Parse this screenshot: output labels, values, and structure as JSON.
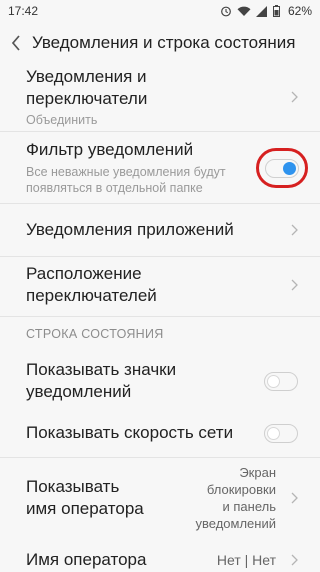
{
  "status_bar": {
    "time": "17:42",
    "battery": "62%"
  },
  "header": {
    "title": "Уведомления и строка состояния"
  },
  "rows": {
    "notif_switches": {
      "title": "Уведомления и\nпереключатели",
      "subtitle": "Объединить"
    },
    "notif_filter": {
      "title": "Фильтр уведомлений",
      "subtitle": "Все неважные уведомления будут\nпоявляться в отдельной папке",
      "toggle": true
    },
    "app_notifs": {
      "title": "Уведомления приложений"
    },
    "switch_layout": {
      "title": "Расположение\nпереключателей"
    },
    "show_icons": {
      "title": "Показывать значки\nуведомлений",
      "toggle": false
    },
    "net_speed": {
      "title": "Показывать скорость сети",
      "toggle": false
    },
    "operator_name_show": {
      "title": "Показывать\nимя оператора",
      "value": "Экран\nблокировки\nи панель\nуведомлений"
    },
    "operator_name": {
      "title": "Имя оператора",
      "value": "Нет | Нет"
    }
  },
  "sections": {
    "status_bar_header": "СТРОКА СОСТОЯНИЯ"
  },
  "colors": {
    "accent": "#2e93ee",
    "highlight": "#d62020"
  }
}
